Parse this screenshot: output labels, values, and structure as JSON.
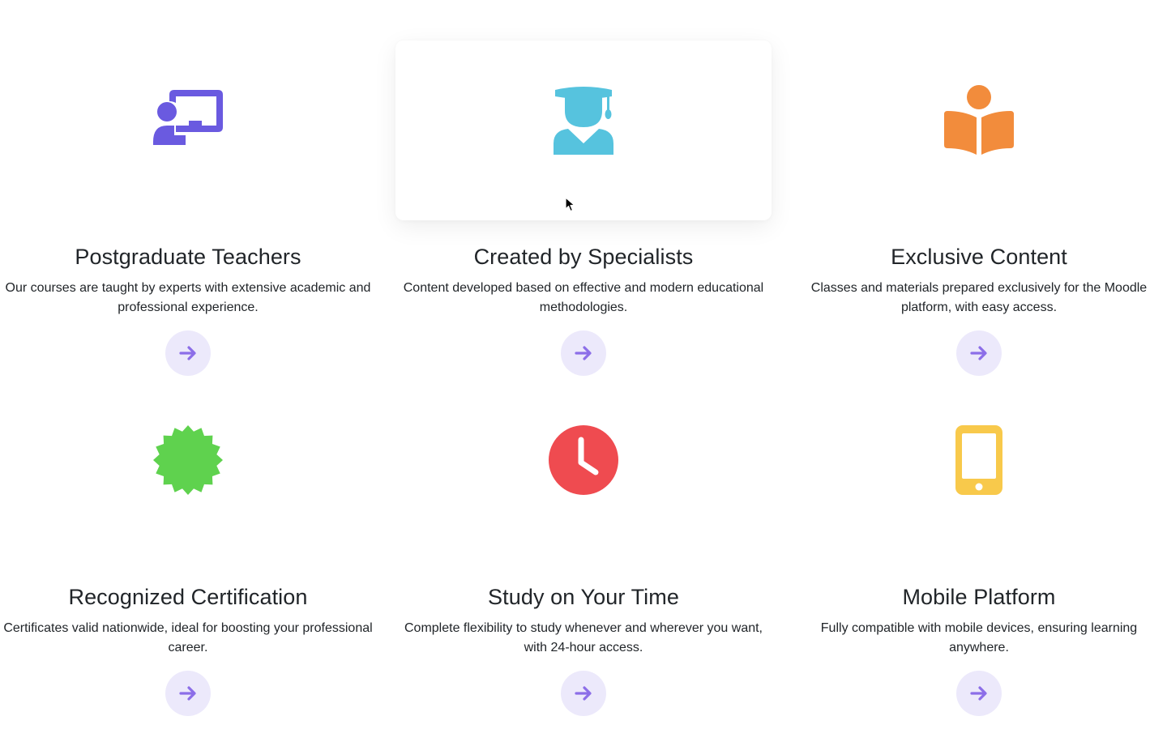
{
  "features": [
    {
      "id": "teachers",
      "icon": "teacher-presentation-icon",
      "icon_color": "#6a5ae0",
      "title": "Postgraduate Teachers",
      "description": "Our courses are taught by experts with extensive academic and professional experience."
    },
    {
      "id": "specialists",
      "icon": "graduate-icon",
      "icon_color": "#56c3de",
      "title": "Created by Specialists",
      "description": "Content developed based on effective and modern educational methodologies."
    },
    {
      "id": "exclusive",
      "icon": "book-reader-icon",
      "icon_color": "#f28c3c",
      "title": "Exclusive Content",
      "description": "Classes and materials prepared exclusively for the Moodle platform, with easy access."
    },
    {
      "id": "certification",
      "icon": "certificate-badge-icon",
      "icon_color": "#5fd24e",
      "title": "Recognized Certification",
      "description": "Certificates valid nationwide, ideal for boosting your professional career."
    },
    {
      "id": "study-time",
      "icon": "clock-icon",
      "icon_color": "#ef4b50",
      "title": "Study on Your Time",
      "description": "Complete flexibility to study whenever and wherever you want, with 24-hour access."
    },
    {
      "id": "mobile",
      "icon": "mobile-icon",
      "icon_color": "#f8c94b",
      "title": "Mobile Platform",
      "description": "Fully compatible with mobile devices, ensuring learning anywhere."
    }
  ],
  "arrow_button": {
    "icon": "arrow-right-icon",
    "background": "#ece9fb",
    "icon_color": "#8c6ee8"
  }
}
